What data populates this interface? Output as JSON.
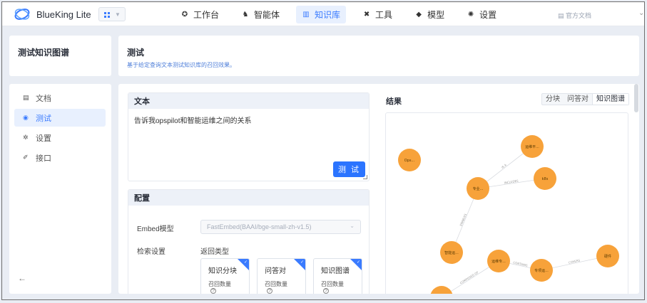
{
  "header": {
    "app_title": "BlueKing Lite",
    "docs_link": "官方文档",
    "nav": [
      {
        "label": "工作台",
        "icon": "bot-icon",
        "glyph": "✪",
        "active": false
      },
      {
        "label": "智能体",
        "icon": "agent-icon",
        "glyph": "♞",
        "active": false
      },
      {
        "label": "知识库",
        "icon": "library-icon",
        "glyph": "▥",
        "active": true
      },
      {
        "label": "工具",
        "icon": "tools-icon",
        "glyph": "✖",
        "active": false
      },
      {
        "label": "模型",
        "icon": "cube-icon",
        "glyph": "◆",
        "active": false
      },
      {
        "label": "设置",
        "icon": "gear-icon",
        "glyph": "✺",
        "active": false
      }
    ]
  },
  "sidebar": {
    "title": "测试知识图谱",
    "items": [
      {
        "label": "文档",
        "icon": "document-icon",
        "glyph": "▤",
        "active": false
      },
      {
        "label": "测试",
        "icon": "test-icon",
        "glyph": "◉",
        "active": true
      },
      {
        "label": "设置",
        "icon": "settings-icon",
        "glyph": "✲",
        "active": false
      },
      {
        "label": "接口",
        "icon": "api-icon",
        "glyph": "✐",
        "active": false
      }
    ]
  },
  "page": {
    "title": "测试",
    "description": "基于给定查询文本测试知识库的召回效果。"
  },
  "text_panel": {
    "header": "文本",
    "query": "告诉我opspilot和智能运维之间的关系",
    "test_button": "测 试"
  },
  "config": {
    "header": "配置",
    "embed_label": "Embed模型",
    "embed_value": "FastEmbed(BAAI/bge-small-zh-v1.5)",
    "retrieval_label": "检索设置",
    "return_type_label": "返回类型",
    "cards": [
      {
        "name": "知识分块",
        "sub": "召回数量"
      },
      {
        "name": "问答对",
        "sub": "召回数量"
      },
      {
        "name": "知识图谱",
        "sub": "召回数量"
      }
    ]
  },
  "results": {
    "title": "结果",
    "tabs": [
      "分块",
      "问答对",
      "知识图谱"
    ],
    "active_tab": "知识图谱",
    "graph": {
      "node_color": "#f7a23a",
      "nodes": [
        {
          "id": "ops",
          "label": "Ops..."
        },
        {
          "id": "yunwei",
          "label": "运维平..."
        },
        {
          "id": "k8s",
          "label": "k8s"
        },
        {
          "id": "zhuanye",
          "label": "专业..."
        },
        {
          "id": "zhineng",
          "label": "智能运..."
        },
        {
          "id": "yunwei2",
          "label": "运维专..."
        },
        {
          "id": "guanli",
          "label": "专项运..."
        },
        {
          "id": "ruanjian",
          "label": "硬件"
        },
        {
          "id": "bottom",
          "label": ""
        }
      ],
      "edges": [
        {
          "from": "zhuanye",
          "to": "yunwei",
          "label": "IS A"
        },
        {
          "from": "zhuanye",
          "to": "k8s",
          "label": "INCLUDES"
        },
        {
          "from": "zhineng",
          "to": "zhuanye",
          "label": "ENABLES"
        },
        {
          "from": "guanli",
          "to": "ruanjian",
          "label": "COVERS"
        },
        {
          "from": "bottom",
          "to": "yunwei2",
          "label": "COMPOSED OF"
        },
        {
          "from": "yunwei2",
          "to": "guanli",
          "label": "CONTAINS"
        }
      ]
    }
  }
}
